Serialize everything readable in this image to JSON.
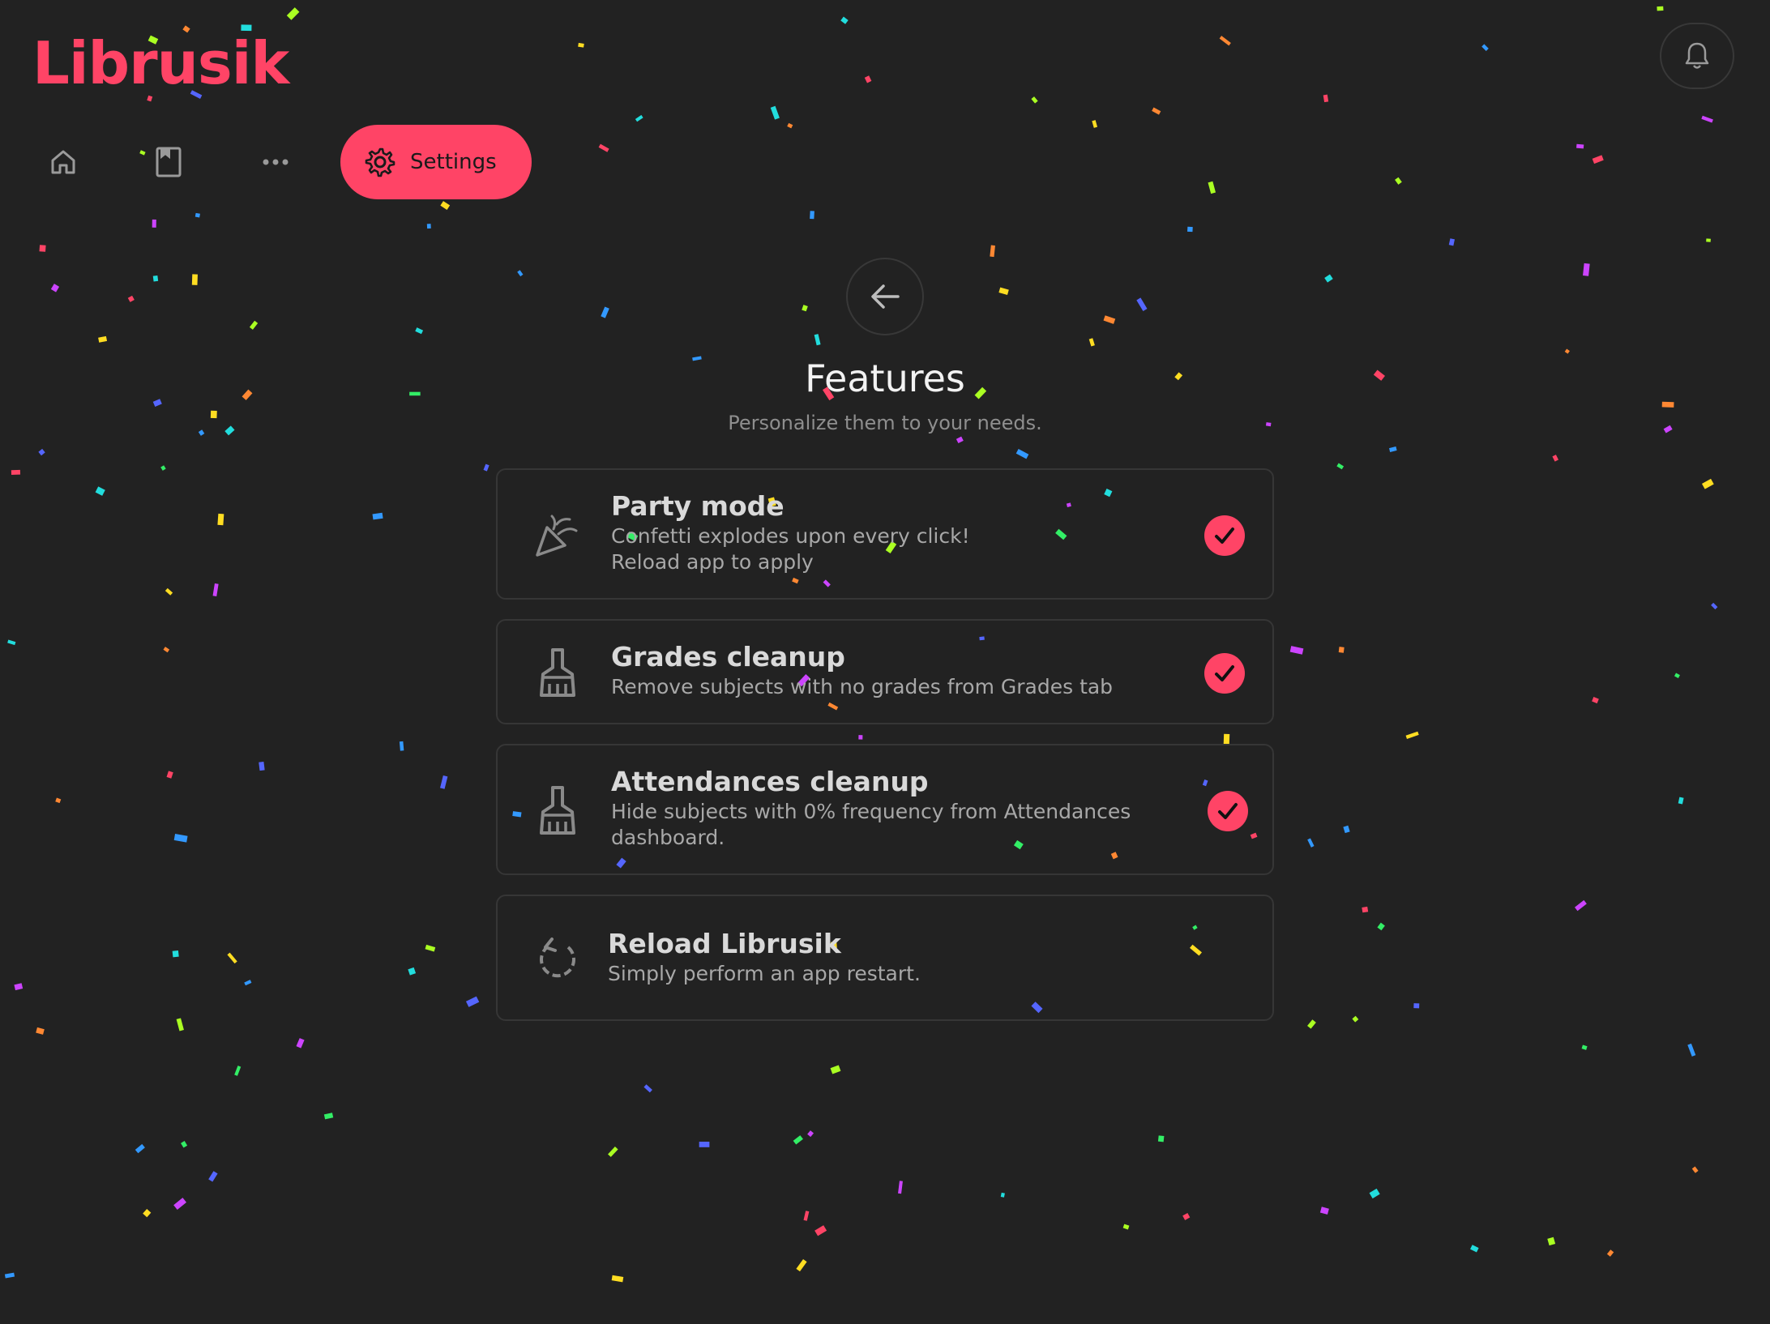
{
  "app": {
    "logo": "Librusik"
  },
  "nav": {
    "items": [
      {
        "name": "home",
        "icon": "home-icon"
      },
      {
        "name": "grades",
        "icon": "book-icon"
      },
      {
        "name": "more",
        "icon": "more-dots-icon"
      }
    ],
    "settings_label": "Settings"
  },
  "page": {
    "title": "Features",
    "subtitle": "Personalize them to your needs."
  },
  "features": [
    {
      "title": "Party mode",
      "desc": "Confetti explodes upon every click!",
      "desc2": "Reload app to apply",
      "icon": "party-popper-icon",
      "enabled": true
    },
    {
      "title": "Grades cleanup",
      "desc": "Remove subjects with no grades from Grades tab",
      "icon": "broom-icon",
      "enabled": true
    },
    {
      "title": "Attendances cleanup",
      "desc": "Hide subjects with 0% frequency from Attendances",
      "desc2": "dashboard.",
      "icon": "broom-icon",
      "enabled": true
    },
    {
      "title": "Reload Librusik",
      "desc": "Simply perform an app restart.",
      "icon": "reload-icon"
    }
  ],
  "colors": {
    "accent": "#ff4466",
    "background": "#222222",
    "card_border": "#363636"
  }
}
